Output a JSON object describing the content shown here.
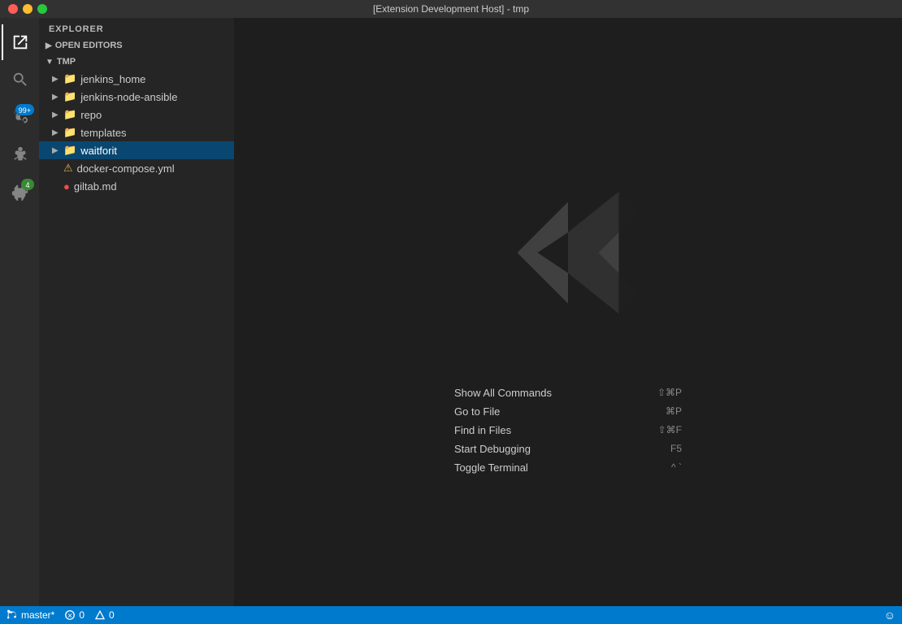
{
  "titleBar": {
    "title": "[Extension Development Host] - tmp"
  },
  "activityBar": {
    "icons": [
      {
        "name": "explorer-icon",
        "label": "Explorer",
        "active": true,
        "badge": null
      },
      {
        "name": "search-icon",
        "label": "Search",
        "active": false,
        "badge": null
      },
      {
        "name": "source-control-icon",
        "label": "Source Control",
        "active": false,
        "badge": "99+"
      },
      {
        "name": "debug-icon",
        "label": "Run and Debug",
        "active": false,
        "badge": null
      },
      {
        "name": "extensions-icon",
        "label": "Extensions",
        "active": false,
        "badge": "4"
      }
    ]
  },
  "sidebar": {
    "title": "EXPLORER",
    "sections": [
      {
        "name": "open-editors",
        "label": "OPEN EDITORS",
        "expanded": false
      },
      {
        "name": "tmp",
        "label": "TMP",
        "expanded": true,
        "items": [
          {
            "name": "jenkins_home",
            "label": "jenkins_home",
            "type": "folder",
            "expanded": false,
            "indent": 1
          },
          {
            "name": "jenkins-node-ansible",
            "label": "jenkins-node-ansible",
            "type": "folder",
            "expanded": false,
            "indent": 1
          },
          {
            "name": "repo",
            "label": "repo",
            "type": "folder",
            "expanded": false,
            "indent": 1
          },
          {
            "name": "templates",
            "label": "templates",
            "type": "folder",
            "expanded": false,
            "indent": 1
          },
          {
            "name": "waitforit",
            "label": "waitforit",
            "type": "folder",
            "expanded": false,
            "indent": 1,
            "selected": true
          },
          {
            "name": "docker-compose.yml",
            "label": "docker-compose.yml",
            "type": "file",
            "status": "warn",
            "indent": 1
          },
          {
            "name": "giltab.md",
            "label": "giltab.md",
            "type": "file",
            "status": "error",
            "indent": 1
          }
        ]
      }
    ]
  },
  "editorWelcome": {
    "shortcuts": [
      {
        "label": "Show All Commands",
        "keys": "⇧⌘P"
      },
      {
        "label": "Go to File",
        "keys": "⌘P"
      },
      {
        "label": "Find in Files",
        "keys": "⇧⌘F"
      },
      {
        "label": "Start Debugging",
        "keys": "F5"
      },
      {
        "label": "Toggle Terminal",
        "keys": "^ `"
      }
    ]
  },
  "statusBar": {
    "branch": "master*",
    "errors": "0",
    "warnings": "0"
  }
}
